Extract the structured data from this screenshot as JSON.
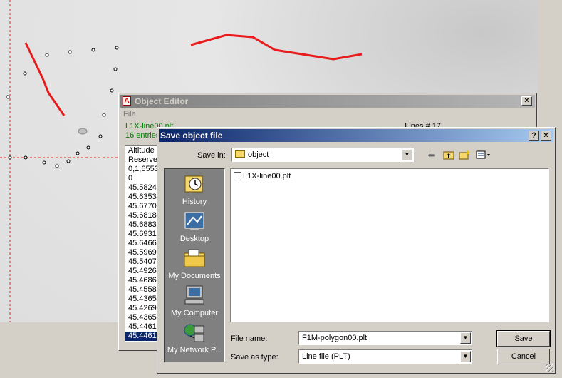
{
  "map": {
    "line_color": "#e81c1c"
  },
  "object_editor": {
    "title": "Object Editor",
    "close_label": "×",
    "menu": {
      "file": "File"
    },
    "file_name": "L1X-line00.plt",
    "entries": "16 entries",
    "lines_label": "Lines # 17",
    "list": [
      "Altitude i",
      "Reserve",
      "0,1,6553",
      "0",
      "45.5824",
      "45.6353",
      "45.6770",
      "45.6818",
      "45.6883",
      "45.6931",
      "45.6466",
      "45.5969",
      "45.5407",
      "45.4926",
      "45.4686",
      "45.4558",
      "45.4365",
      "45.4269",
      "45.4365",
      "45.4461",
      "45.4461"
    ]
  },
  "dialog": {
    "title": "Save object file",
    "help_label": "?",
    "close_label": "×",
    "save_in_label": "Save in:",
    "save_in_value": "object",
    "places": [
      {
        "label": "History",
        "icon": "history-icon"
      },
      {
        "label": "Desktop",
        "icon": "desktop-icon"
      },
      {
        "label": "My Documents",
        "icon": "my-documents-icon"
      },
      {
        "label": "My Computer",
        "icon": "my-computer-icon"
      },
      {
        "label": "My Network P...",
        "icon": "my-network-places-icon"
      }
    ],
    "files": [
      "L1X-line00.plt"
    ],
    "file_name_label": "File name:",
    "file_name_value": "F1M-polygon00.plt",
    "save_type_label": "Save as type:",
    "save_type_value": "Line file (PLT)",
    "save_button": "Save",
    "cancel_button": "Cancel"
  }
}
